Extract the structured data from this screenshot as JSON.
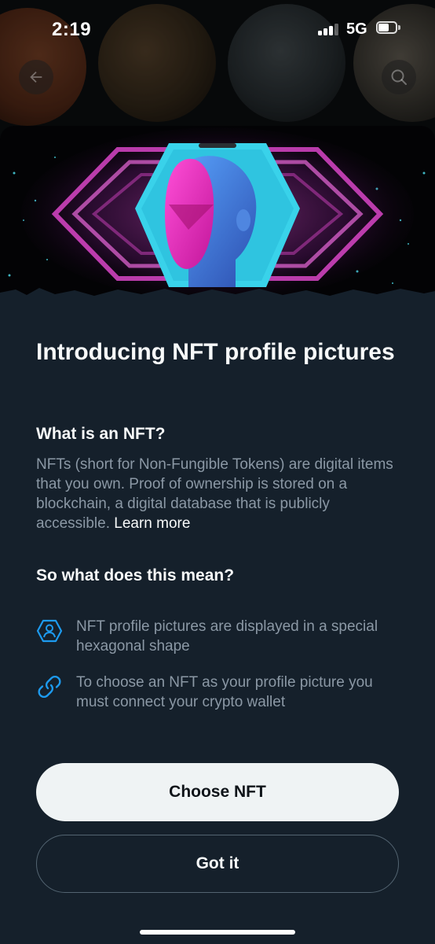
{
  "status_bar": {
    "time": "2:19",
    "network": "5G",
    "signal_bars": 3,
    "battery_level": 0.6
  },
  "nav": {
    "back_icon": "arrow-left-icon",
    "search_icon": "search-icon"
  },
  "content": {
    "title": "Introducing NFT profile pictures",
    "what_heading": "What is an NFT?",
    "what_body": "NFTs (short for Non-Fungible Tokens) are digital items that you own. Proof of ownership is stored on a blockchain, a digital database that is publicly accessible.",
    "learn_more": "Learn more",
    "meaning_heading": "So what does this mean?",
    "features": [
      {
        "icon": "hexagon-profile-icon",
        "text": "NFT profile pictures are displayed in a special hexagonal shape"
      },
      {
        "icon": "link-icon",
        "text": "To choose an NFT as your profile picture you must connect your crypto wallet"
      }
    ]
  },
  "actions": {
    "primary_label": "Choose NFT",
    "secondary_label": "Got it"
  },
  "colors": {
    "background": "#15202b",
    "accent_icon": "#1d9bf0",
    "muted_text": "#8b98a5",
    "primary_button": "#eff3f4",
    "hero_cyan": "#37d3ea",
    "hero_magenta": "#e93bd6"
  }
}
